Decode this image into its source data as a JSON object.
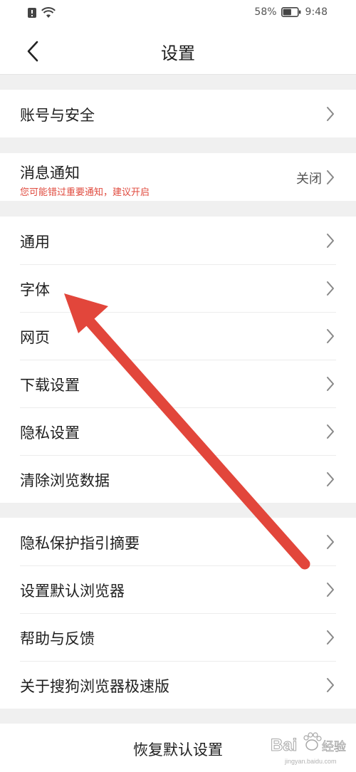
{
  "status_bar": {
    "battery_percent": "58%",
    "time": "9:48",
    "battery_level": 0.58
  },
  "header": {
    "title": "设置"
  },
  "groups": [
    {
      "items": [
        {
          "label": "账号与安全"
        }
      ]
    },
    {
      "items": [
        {
          "label": "消息通知",
          "subtitle": "您可能错过重要通知，建议开启",
          "value": "关闭"
        }
      ]
    },
    {
      "items": [
        {
          "label": "通用"
        },
        {
          "label": "字体"
        },
        {
          "label": "网页"
        },
        {
          "label": "下载设置"
        },
        {
          "label": "隐私设置"
        },
        {
          "label": "清除浏览数据"
        }
      ]
    },
    {
      "items": [
        {
          "label": "隐私保护指引摘要"
        },
        {
          "label": "设置默认浏览器"
        },
        {
          "label": "帮助与反馈"
        },
        {
          "label": "关于搜狗浏览器极速版"
        }
      ]
    }
  ],
  "footer": {
    "restore_label": "恢复默认设置"
  },
  "watermark": {
    "text": "Bai 经验",
    "url": "jingyan.baidu.com"
  },
  "colors": {
    "annotation_arrow": "#e2463b",
    "warning_text": "#e04b3f",
    "background": "#f0f0f0"
  }
}
